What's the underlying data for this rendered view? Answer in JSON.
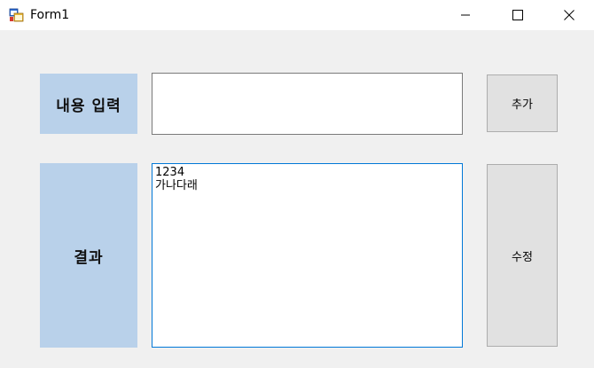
{
  "window": {
    "title": "Form1",
    "icon": "winforms-app-icon",
    "controls": [
      "minimize-icon",
      "maximize-icon",
      "close-icon"
    ]
  },
  "form": {
    "input_label": "내용 입력",
    "input_value": "",
    "result_label": "결과",
    "result_lines": [
      "1234",
      "가나다래"
    ],
    "add_button": "추가",
    "edit_button": "수정"
  },
  "colors": {
    "label_bg": "#b9d1ea",
    "form_bg": "#f0f0f0",
    "focus_border": "#0078d7",
    "button_bg": "#e1e1e1"
  }
}
